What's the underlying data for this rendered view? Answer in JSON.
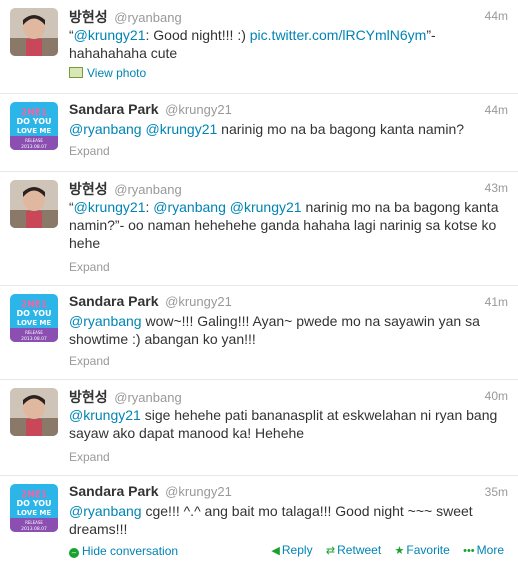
{
  "tweets": [
    {
      "name": "방현성",
      "screen": "@ryanbang",
      "time": "44m",
      "text_parts": [
        "“",
        "@krungy21",
        ": Good night!!! :) ",
        "pic.twitter.com/lRCYmlN6ym",
        "”- hahahahaha cute"
      ],
      "meta": "View photo"
    },
    {
      "name": "Sandara Park",
      "screen": "@krungy21",
      "time": "44m",
      "text_parts": [
        "@ryanbang",
        " ",
        "@krungy21",
        " narinig mo na ba bagong kanta namin?"
      ],
      "meta": "Expand"
    },
    {
      "name": "방현성",
      "screen": "@ryanbang",
      "time": "43m",
      "text_parts": [
        "“",
        "@krungy21",
        ": ",
        "@ryanbang",
        " ",
        "@krungy21",
        " narinig mo na ba bagong kanta namin?”- oo naman hehehehe ganda hahaha lagi narinig sa kotse ko hehe"
      ],
      "meta": "Expand"
    },
    {
      "name": "Sandara Park",
      "screen": "@krungy21",
      "time": "41m",
      "text_parts": [
        "@ryanbang",
        " wow~!!! Galing!!! Ayan~ pwede mo na sayawin yan sa showtime :) abangan ko yan!!!"
      ],
      "meta": "Expand"
    },
    {
      "name": "방현성",
      "screen": "@ryanbang",
      "time": "40m",
      "text_parts": [
        "@krungy21",
        " sige hehehe pati bananasplit at eskwelahan ni ryan bang sayaw ako dapat manood ka! Hehehe"
      ],
      "meta": "Expand"
    },
    {
      "name": "Sandara Park",
      "screen": "@krungy21",
      "time": "35m",
      "text_parts": [
        "@ryanbang",
        " cge!!! ^.^ ang bait mo talaga!!! Good night ~~~ sweet dreams!!!"
      ],
      "meta": "Hide conversation"
    }
  ],
  "avatar_text": {
    "line1": "2NE1",
    "line2": "DO YOU",
    "line3": "LOVE ME",
    "line4": "RELEASE",
    "line5": "2013.08.07"
  },
  "actions": {
    "reply": "Reply",
    "retweet": "Retweet",
    "favorite": "Favorite",
    "more": "More"
  },
  "colors": {
    "link": "#0084b4",
    "icon_green": "#19a12f"
  }
}
